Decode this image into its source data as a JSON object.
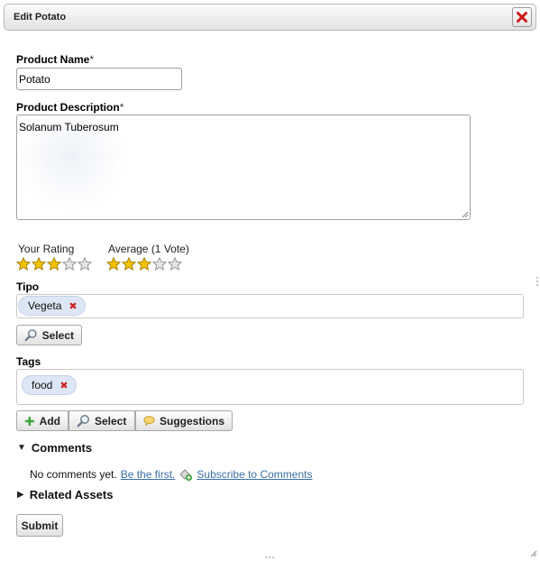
{
  "dialog": {
    "title": "Edit Potato"
  },
  "form": {
    "product_name": {
      "label": "Product Name",
      "required_mark": "*",
      "value": "Potato"
    },
    "product_description": {
      "label": "Product Description",
      "required_mark": "*",
      "value": "Solanum Tuberosum"
    },
    "ratings": {
      "your_rating_label": "Your Rating",
      "your_rating_value": 3,
      "average_label": "Average (1 Vote)",
      "average_value": 3,
      "max_stars": 5
    },
    "tipo": {
      "label": "Tipo",
      "chips": [
        "Vegeta"
      ],
      "select_button": "Select"
    },
    "tags": {
      "label": "Tags",
      "chips": [
        "food"
      ],
      "add_button": "Add",
      "select_button": "Select",
      "suggestions_button": "Suggestions"
    },
    "comments": {
      "heading": "Comments",
      "no_comments_text": "No comments yet.",
      "be_first_link": "Be the first.",
      "subscribe_link": "Subscribe to Comments"
    },
    "related_assets": {
      "heading": "Related Assets"
    },
    "submit_button": "Submit"
  },
  "colors": {
    "star_filled": "#f2c200",
    "star_empty": "#e4e4e4",
    "link": "#3b6fa8",
    "chip_bg": "#dde6f4",
    "remove_x": "#cc2222"
  },
  "icons": {
    "close": "close-icon",
    "select": "magnifier-icon",
    "add": "plus-icon",
    "suggestions": "speech-bubble-icon",
    "subscribe": "subscribe-icon",
    "expanded": "triangle-down-icon",
    "collapsed": "triangle-right-icon"
  }
}
